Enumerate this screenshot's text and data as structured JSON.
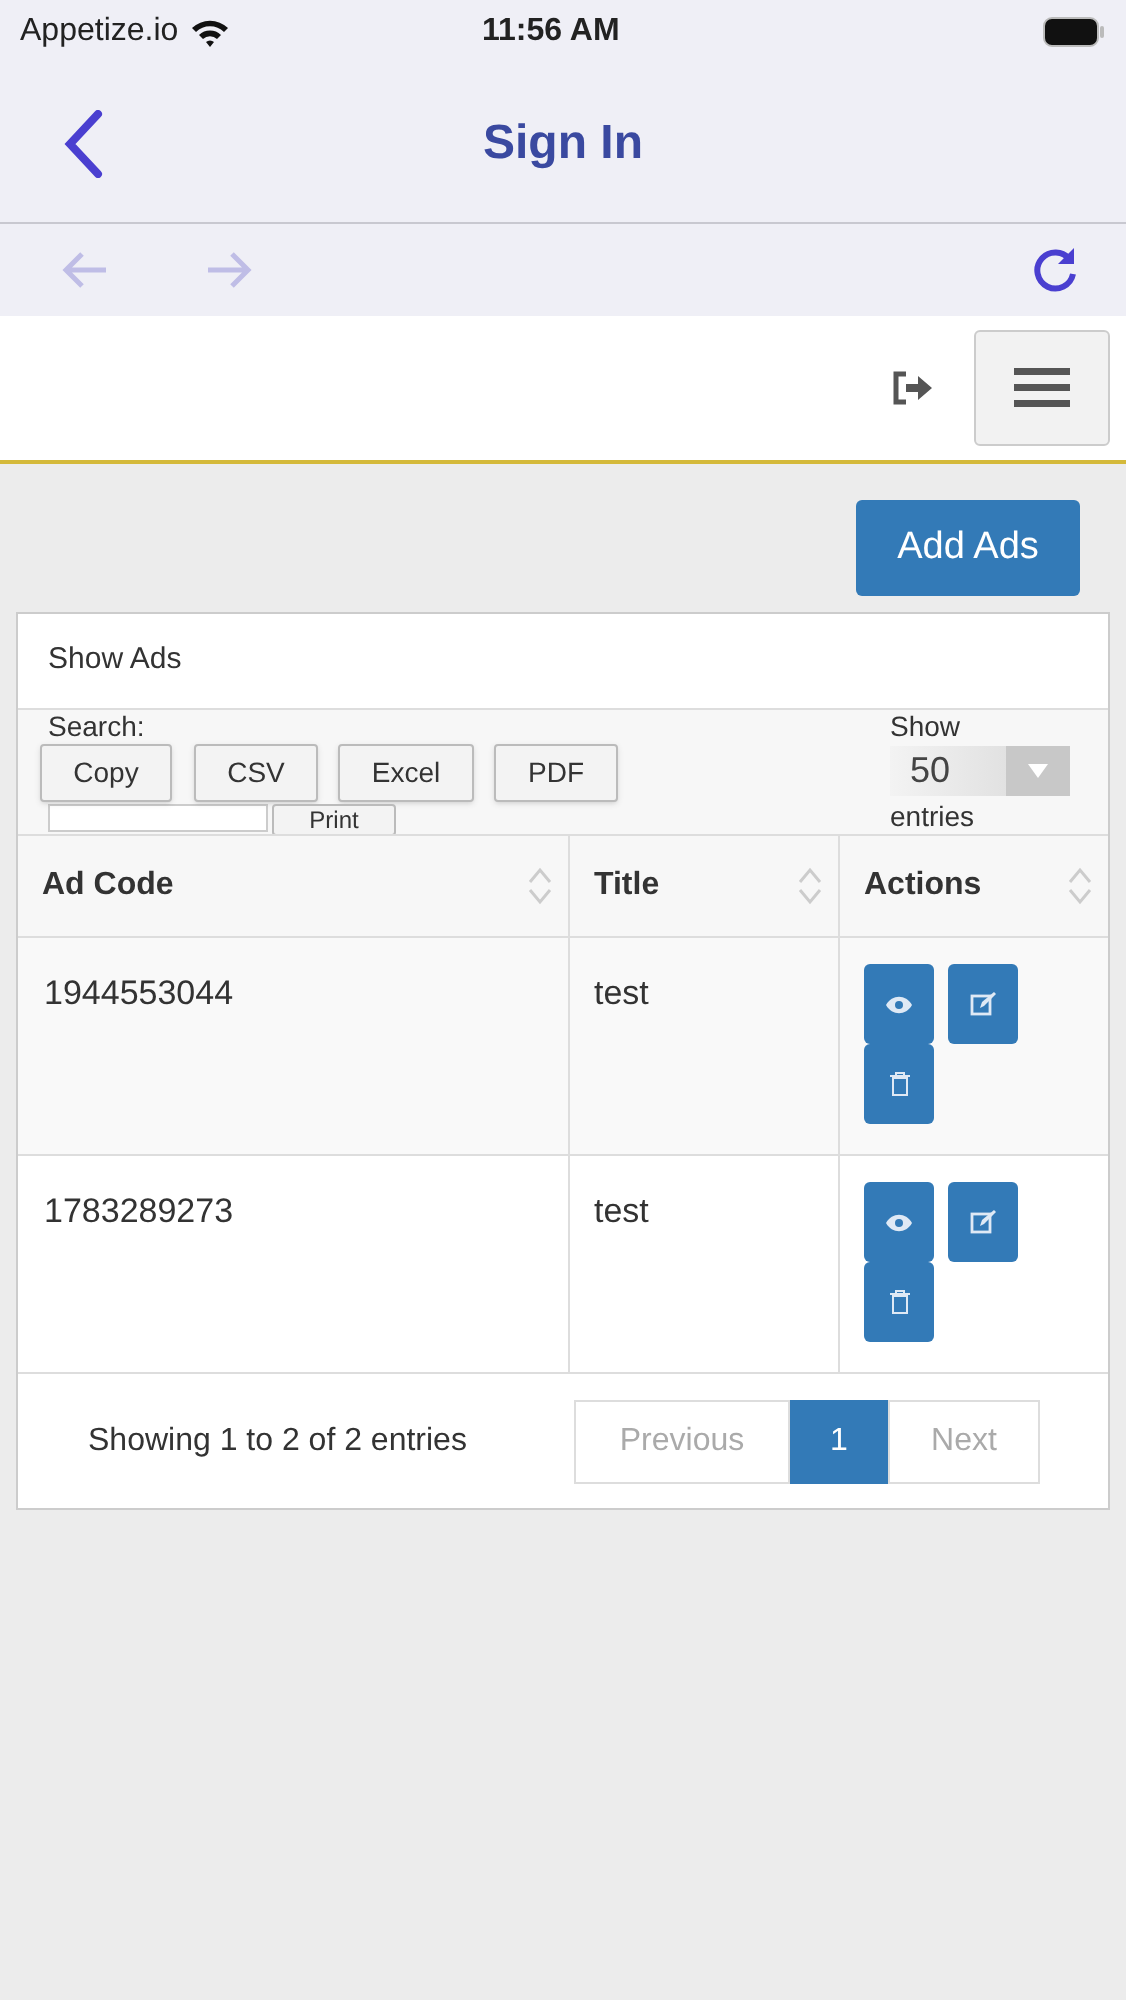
{
  "status_bar": {
    "carrier": "Appetize.io",
    "time": "11:56 AM"
  },
  "nav": {
    "title": "Sign In"
  },
  "browser_toolbar": {
    "back": {
      "disabled": true
    },
    "forward": {
      "disabled": true
    }
  },
  "primary_button": "Add Ads",
  "panel": {
    "heading": "Show Ads",
    "search_label": "Search:",
    "export_buttons": [
      "Copy",
      "CSV",
      "Excel",
      "PDF",
      "Print"
    ],
    "length": {
      "label_before": "Show",
      "value": "50",
      "label_after": "entries"
    },
    "columns": [
      {
        "label": "Ad Code"
      },
      {
        "label": "Title"
      },
      {
        "label": "Actions"
      }
    ],
    "rows": [
      {
        "ad_code": "1944553044",
        "title": "test"
      },
      {
        "ad_code": "1783289273",
        "title": "test"
      }
    ],
    "info": "Showing 1 to 2 of 2 entries",
    "pagination": [
      {
        "label": "Previous",
        "kind": "nav",
        "disabled": true,
        "selected": false
      },
      {
        "label": "1",
        "kind": "page",
        "selected": true
      },
      {
        "label": "Next",
        "kind": "nav",
        "disabled": true,
        "selected": false
      }
    ]
  }
}
